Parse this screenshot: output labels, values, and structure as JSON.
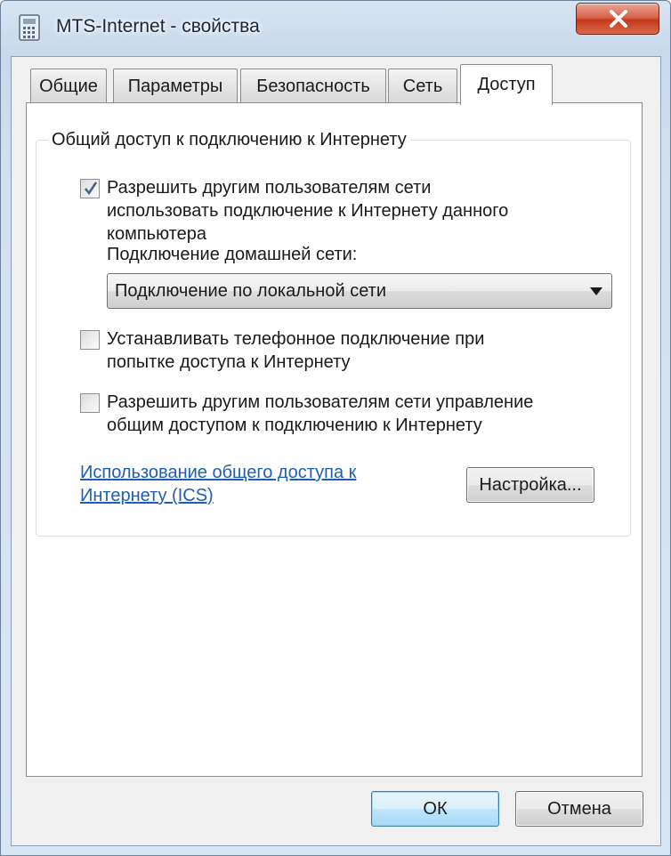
{
  "window": {
    "title": "MTS-Internet - свойства",
    "icon": "network-connection-icon",
    "close_icon": "close-icon"
  },
  "tabs": [
    {
      "label": "Общие",
      "active": false
    },
    {
      "label": "Параметры",
      "active": false
    },
    {
      "label": "Безопасность",
      "active": false
    },
    {
      "label": "Сеть",
      "active": false
    },
    {
      "label": "Доступ",
      "active": true
    }
  ],
  "sharing": {
    "group_title": "Общий доступ к подключению к Интернету",
    "allow_sharing": {
      "checked": true,
      "line1": "Разрешить другим пользователям сети",
      "line2": "использовать подключение к Интернету данного",
      "line3": "компьютера"
    },
    "home_network_label": "Подключение домашней сети:",
    "home_network_value": "Подключение по локальной сети",
    "dial_on_demand": {
      "checked": false,
      "line1": "Устанавливать телефонное подключение при",
      "line2": "попытке доступа к Интернету"
    },
    "allow_control": {
      "checked": false,
      "line1": "Разрешить другим пользователям сети управление",
      "line2": "общим доступом к подключению к Интернету"
    },
    "ics_link_line1": "Использование общего доступа к",
    "ics_link_line2": "Интернету (ICS)",
    "settings_button": "Настройка..."
  },
  "footer": {
    "ok_label": "ОК",
    "cancel_label": "Отмена"
  }
}
